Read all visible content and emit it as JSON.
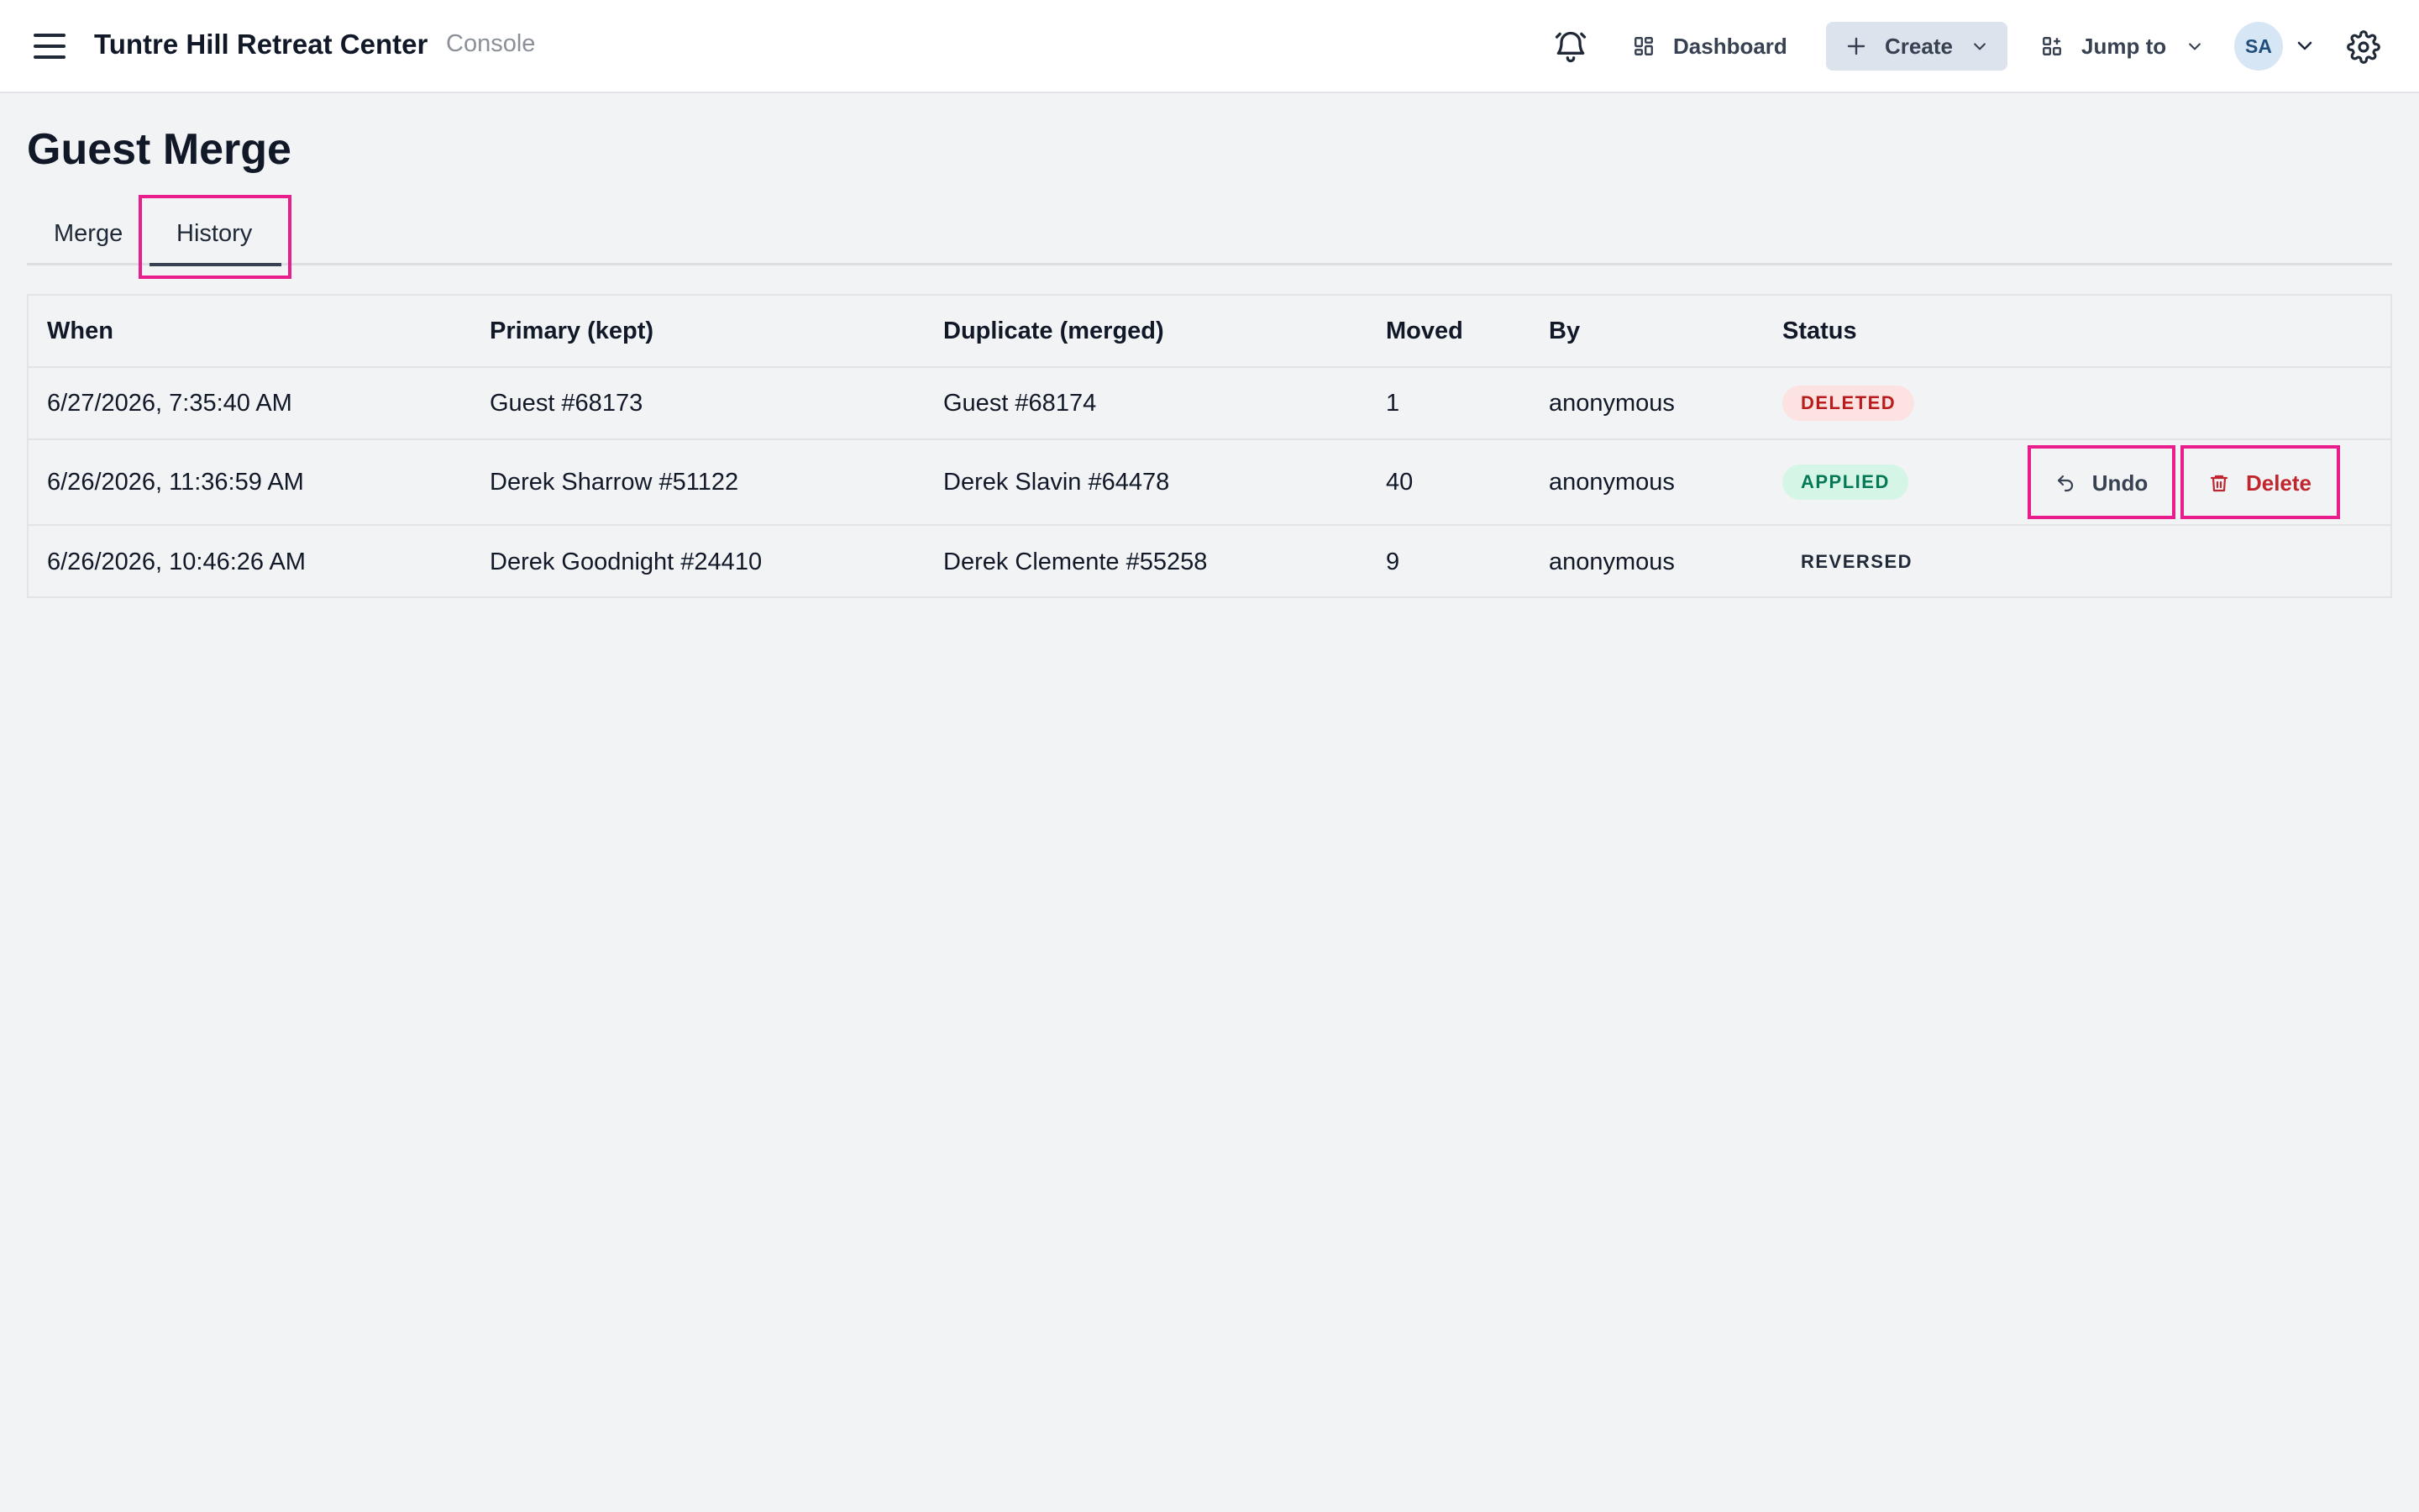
{
  "header": {
    "brand": "Tuntre Hill Retreat Center",
    "subtitle": "Console",
    "dashboard_label": "Dashboard",
    "create_label": "Create",
    "jump_label": "Jump to",
    "avatar_initials": "SA",
    "icons": [
      "menu-icon",
      "bell-icon",
      "dashboard-grid-icon",
      "plus-icon",
      "chevron-down-icon",
      "apps-icon",
      "gear-icon"
    ]
  },
  "page": {
    "title": "Guest Merge",
    "tabs": [
      {
        "label": "Merge",
        "active": false
      },
      {
        "label": "History",
        "active": true
      }
    ]
  },
  "table": {
    "columns": [
      "When",
      "Primary (kept)",
      "Duplicate (merged)",
      "Moved",
      "By",
      "Status"
    ],
    "rows": [
      {
        "when": "6/27/2026, 7:35:40 AM",
        "primary": "Guest #68173",
        "duplicate": "Guest #68174",
        "moved": "1",
        "by": "anonymous",
        "status": "DELETED"
      },
      {
        "when": "6/26/2026, 11:36:59 AM",
        "primary": "Derek Sharrow #51122",
        "duplicate": "Derek Slavin #64478",
        "moved": "40",
        "by": "anonymous",
        "status": "APPLIED",
        "actions": {
          "undo": "Undo",
          "delete": "Delete"
        }
      },
      {
        "when": "6/26/2026, 10:46:26 AM",
        "primary": "Derek Goodnight #24410",
        "duplicate": "Derek Clemente #55258",
        "moved": "9",
        "by": "anonymous",
        "status": "REVERSED"
      }
    ]
  },
  "colors": {
    "highlight": "#e91e8c",
    "deleted_bg": "#fde2e2",
    "deleted_text": "#b91c1c",
    "applied_bg": "#d5f6e6",
    "applied_text": "#047857",
    "delete_action": "#c0262d"
  }
}
